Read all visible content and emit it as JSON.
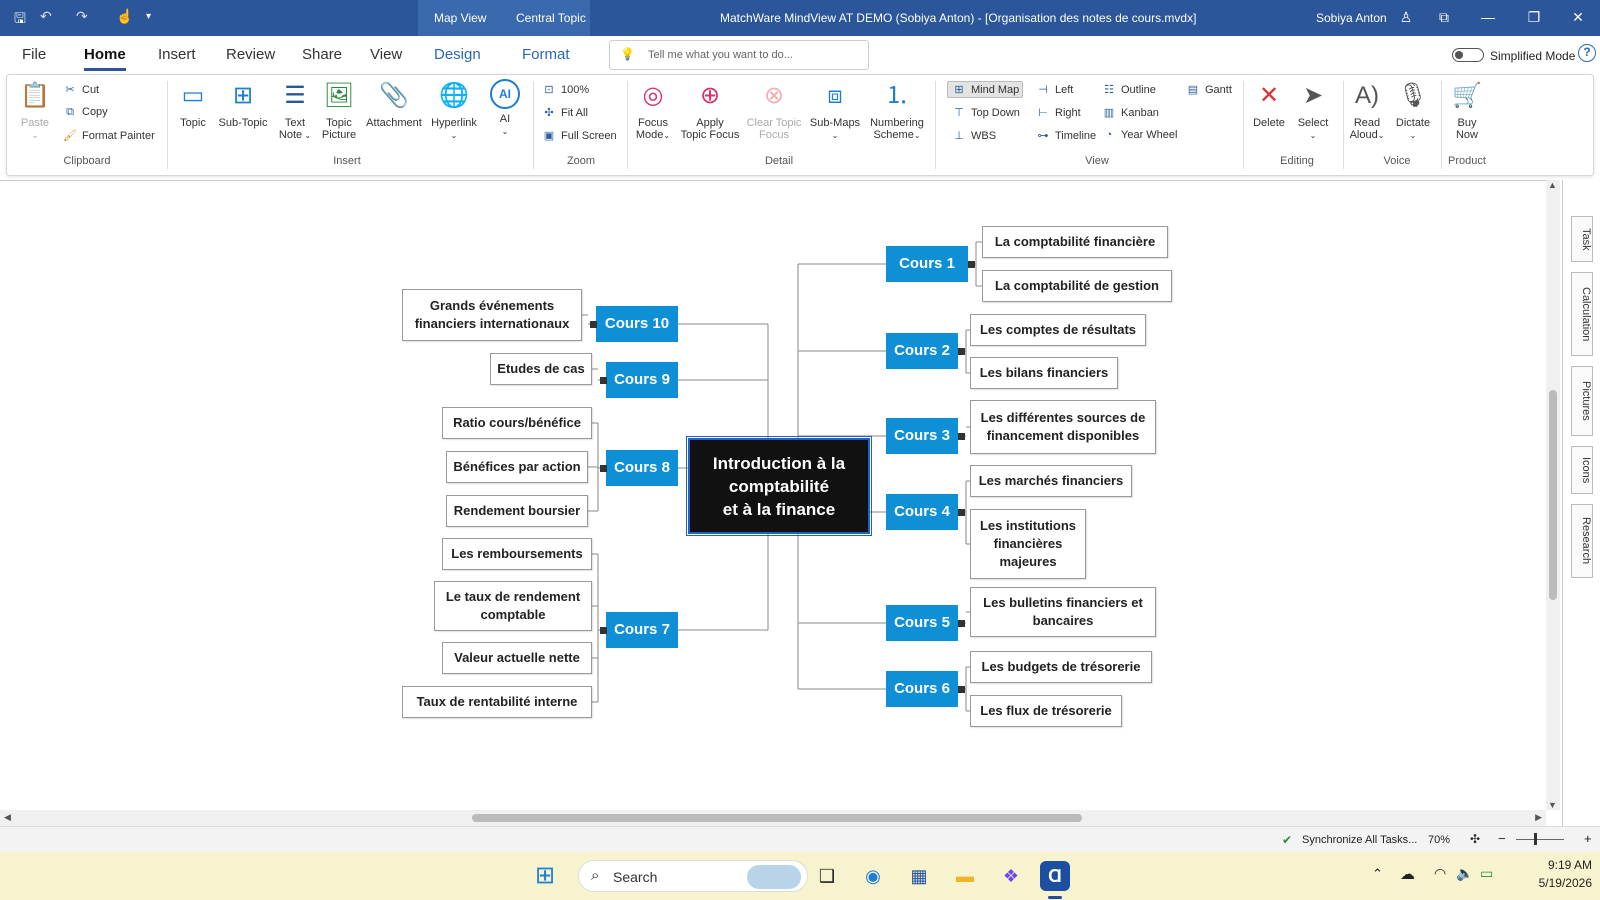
{
  "window": {
    "title": "MatchWare MindView AT DEMO (Sobiya Anton) - [Organisation des notes de cours.mvdx]",
    "user": "Sobiya Anton",
    "context_tabs": [
      "Map View",
      "Central Topic"
    ]
  },
  "menu": {
    "file": "File",
    "home": "Home",
    "insert": "Insert",
    "review": "Review",
    "share": "Share",
    "view": "View",
    "design": "Design",
    "format": "Format"
  },
  "tellme": {
    "placeholder": "Tell me what you want to do..."
  },
  "simplified_mode": "Simplified Mode",
  "ribbon": {
    "clipboard": {
      "label": "Clipboard",
      "paste": "Paste",
      "cut": "Cut",
      "copy": "Copy",
      "format_painter": "Format Painter"
    },
    "insert": {
      "label": "Insert",
      "topic": "Topic",
      "subtopic": "Sub-Topic",
      "text_note": [
        "Text",
        "Note"
      ],
      "topic_picture": [
        "Topic",
        "Picture"
      ],
      "attachment": "Attachment",
      "hyperlink": "Hyperlink",
      "ai": "AI"
    },
    "zoom": {
      "label": "Zoom",
      "z100": "100%",
      "fit_all": "Fit All",
      "full_screen": "Full Screen"
    },
    "detail": {
      "label": "Detail",
      "focus_mode": [
        "Focus",
        "Mode"
      ],
      "apply_topic_focus": [
        "Apply",
        "Topic Focus"
      ],
      "clear_topic_focus": [
        "Clear Topic",
        "Focus"
      ],
      "sub_maps": "Sub-Maps",
      "numbering_scheme": [
        "Numbering",
        "Scheme"
      ]
    },
    "view": {
      "label": "View",
      "mind_map": "Mind Map",
      "top_down": "Top Down",
      "wbs": "WBS",
      "left": "Left",
      "right": "Right",
      "timeline": "Timeline",
      "outline": "Outline",
      "kanban": "Kanban",
      "year_wheel": "Year Wheel",
      "gantt": "Gantt"
    },
    "editing": {
      "label": "Editing",
      "delete": "Delete",
      "select": "Select"
    },
    "voice": {
      "label": "Voice",
      "read_aloud": [
        "Read",
        "Aloud"
      ],
      "dictate": "Dictate"
    },
    "product": {
      "label": "Product",
      "buy_now": [
        "Buy",
        "Now"
      ]
    }
  },
  "side_tabs": [
    "Task",
    "Calculation",
    "Pictures",
    "Icons",
    "Research"
  ],
  "status": {
    "sync": "Synchronize All Tasks...",
    "zoom": "70%"
  },
  "taskbar": {
    "search": "Search",
    "time": "9:19 AM",
    "date": "5/19/2026"
  },
  "mindmap": {
    "central": [
      "Introduction à la",
      "comptabilité",
      "et à la finance"
    ],
    "courses": [
      {
        "name": "Cours 1",
        "topics": [
          [
            "La comptabilité financière"
          ],
          [
            "La comptabilité de gestion"
          ]
        ]
      },
      {
        "name": "Cours 2",
        "topics": [
          [
            "Les comptes de résultats"
          ],
          [
            "Les bilans financiers"
          ]
        ]
      },
      {
        "name": "Cours 3",
        "topics": [
          [
            "Les différentes sources de",
            "financement disponibles"
          ]
        ]
      },
      {
        "name": "Cours 4",
        "topics": [
          [
            "Les marchés financiers"
          ],
          [
            "Les institutions",
            "financières",
            "majeures"
          ]
        ]
      },
      {
        "name": "Cours 5",
        "topics": [
          [
            "Les bulletins financiers et",
            "bancaires"
          ]
        ]
      },
      {
        "name": "Cours 6",
        "topics": [
          [
            "Les budgets de trésorerie"
          ],
          [
            "Les flux de trésorerie"
          ]
        ]
      },
      {
        "name": "Cours 7",
        "topics": [
          [
            "Les remboursements"
          ],
          [
            "Le taux de rendement",
            "comptable"
          ],
          [
            "Valeur actuelle nette"
          ],
          [
            "Taux de rentabilité interne"
          ]
        ]
      },
      {
        "name": "Cours 8",
        "topics": [
          [
            "Ratio cours/bénéfice"
          ],
          [
            "Bénéfices par action"
          ],
          [
            "Rendement boursier"
          ]
        ]
      },
      {
        "name": "Cours 9",
        "topics": [
          [
            "Etudes de cas"
          ]
        ]
      },
      {
        "name": "Cours 10",
        "topics": [
          [
            "Grands événements",
            "financiers internationaux"
          ]
        ]
      }
    ]
  },
  "colors": {
    "title_bar": "#2b579a",
    "topic_blue": "#0e8fd6",
    "central_bg": "#111111",
    "taskbar": "#f7f3cf"
  }
}
